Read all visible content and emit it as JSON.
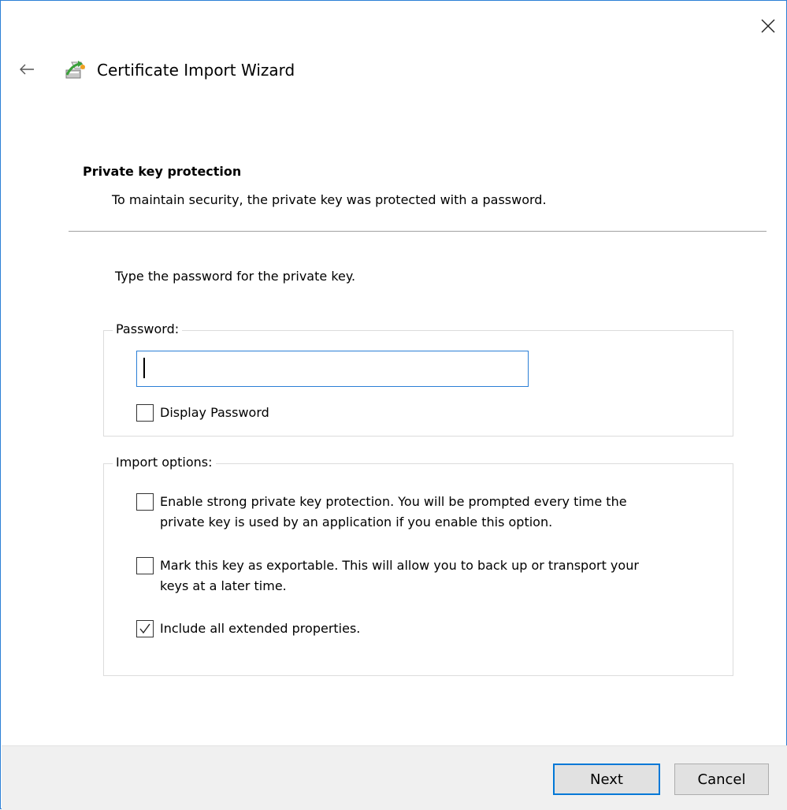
{
  "window": {
    "close_icon": "close-icon",
    "back_icon": "back-arrow-icon",
    "wizard_icon": "certificate-wizard-icon",
    "title": "Certificate Import Wizard",
    "accent_color": "#2b7fd6"
  },
  "header": {
    "section_title": "Private key protection",
    "section_description": "To maintain security, the private key was protected with a password."
  },
  "main": {
    "instruction": "Type the password for the private key.",
    "password_group": {
      "legend": "Password:",
      "value": "",
      "display_password_label": "Display Password",
      "display_password_checked": false
    },
    "import_group": {
      "legend": "Import options:",
      "options": [
        {
          "line1": "Enable strong private key protection. You will be prompted every time the",
          "line2": "private key is used by an application if you enable this option.",
          "checked": false
        },
        {
          "line1": "Mark this key as exportable. This will allow you to back up or transport your",
          "line2": "keys at a later time.",
          "checked": false
        },
        {
          "line1": "Include all extended properties.",
          "line2": "",
          "checked": true
        }
      ]
    }
  },
  "footer": {
    "next_label": "Next",
    "cancel_label": "Cancel"
  }
}
